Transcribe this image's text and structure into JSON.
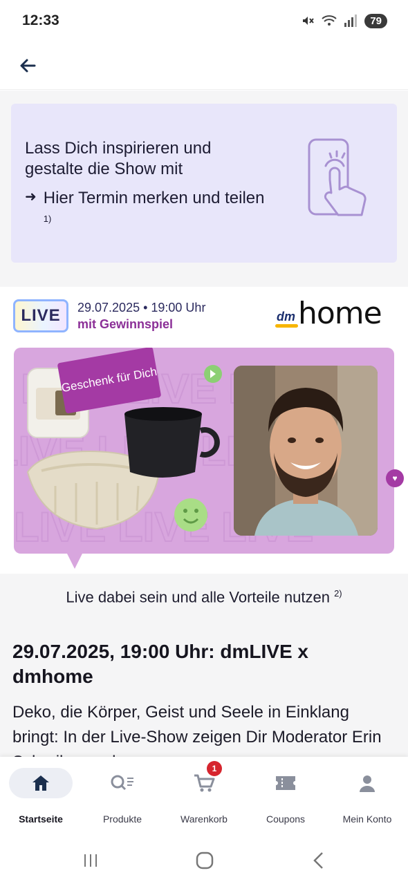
{
  "status": {
    "time": "12:33",
    "battery": "79"
  },
  "promo": {
    "title": "Lass Dich inspirieren und gestalte die Show mit",
    "link_text": "Hier Termin merken und teilen",
    "link_footnote": "1)"
  },
  "live": {
    "badge": "LIVE",
    "date_time": "29.07.2025 • 19:00 Uhr",
    "subtitle": "mit Gewinnspiel",
    "logo_dm": "dm",
    "logo_home": "home",
    "gift_label": "Geschenk für Dich"
  },
  "info": {
    "text": "Live dabei sein und alle Vorteile nutzen",
    "footnote": "2)"
  },
  "article": {
    "title": "29.07.2025, 19:00 Uhr: dmLIVE x dmhome",
    "body": "Deko, die Körper, Geist und Seele in Einklang bringt: In der Live-Show zeigen Dir Moderator Erin Schreiber und …"
  },
  "nav": {
    "items": [
      {
        "label": "Startseite",
        "icon": "home-icon",
        "active": true
      },
      {
        "label": "Produkte",
        "icon": "product-search-icon"
      },
      {
        "label": "Warenkorb",
        "icon": "cart-icon",
        "badge": "1"
      },
      {
        "label": "Coupons",
        "icon": "coupon-icon"
      },
      {
        "label": "Mein Konto",
        "icon": "account-icon"
      }
    ]
  },
  "colors": {
    "accent_purple": "#8b2f97",
    "banner_bg": "#d8a6de",
    "promo_bg": "#e8e6fa",
    "nav_active_bg": "#eceef4",
    "badge_red": "#d6252e"
  }
}
